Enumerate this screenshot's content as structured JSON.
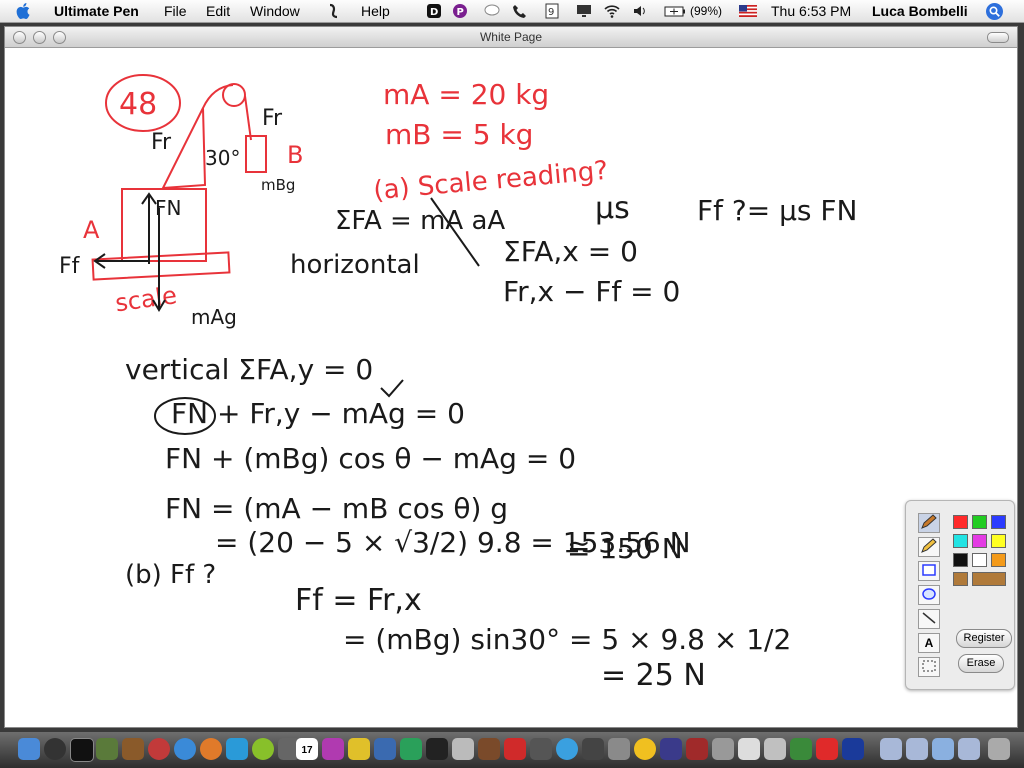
{
  "menubar": {
    "app_name": "Ultimate Pen",
    "menus": [
      "File",
      "Edit",
      "Window",
      "Help"
    ],
    "battery": "(99%)",
    "clock": "Thu 6:53 PM",
    "user": "Luca Bombelli"
  },
  "window": {
    "title": "White Page"
  },
  "notes": {
    "problem_number": "48",
    "labels_red": {
      "fr_top": "Fr",
      "fr_left": "Fr",
      "angle": "30°",
      "box_b": "B",
      "box_a": "A",
      "ff_left": "Ff",
      "scale": "scale",
      "given_ma": "mA = 20 kg",
      "given_mb": "mB = 5 kg",
      "question_a": "(a) Scale reading?"
    },
    "labels_black": {
      "mbg": "mBg",
      "fn": "FN",
      "mag": "mAg"
    },
    "lines": [
      "ΣFA = mA aA",
      "horizontal",
      "μs",
      "Ff ?= μs FN",
      "ΣFA,x = 0",
      "Fr,x − Ff = 0",
      "vertical  ΣFA,y = 0",
      "FN + Fr,y − mAg = 0",
      "FN + (mBg) cos θ − mAg = 0",
      "FN = (mA − mB cos θ) g",
      "= (20 − 5 × √3/2) 9.8 = 153.56 N",
      "≅ 150 N",
      "(b)  Ff ?",
      "Ff = Fr,x",
      "= (mBg) sin30° = 5 × 9.8 × 1/2",
      "= 25 N"
    ]
  },
  "palette": {
    "colors": [
      "#ff2a2a",
      "#22cc22",
      "#2b3bff",
      "#22e3e3",
      "#e33be3",
      "#ffff22",
      "#111111",
      "#ffffff",
      "#f39a1a",
      "#b07a3a",
      "#b07a3a"
    ],
    "register_label": "Register",
    "erase_label": "Erase",
    "text_tool": "A"
  },
  "dock": {
    "calendar_day": "17"
  }
}
